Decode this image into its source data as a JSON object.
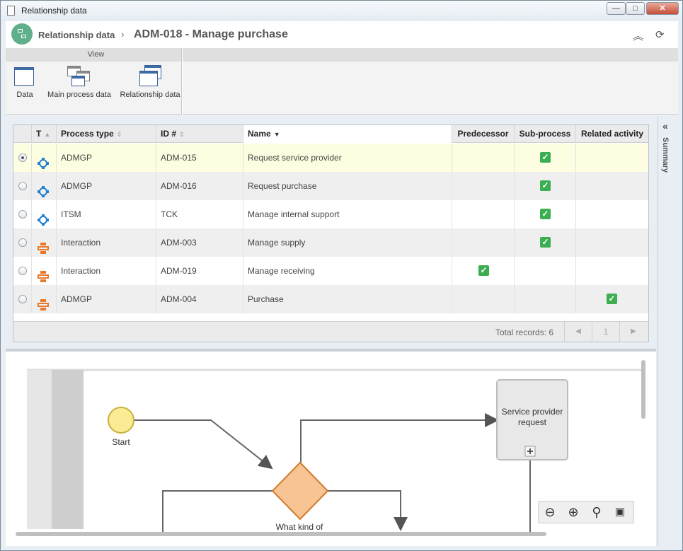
{
  "window": {
    "title": "Relationship data",
    "buttons": {
      "minimize": "—",
      "maximize": "□",
      "close": "✕"
    }
  },
  "header": {
    "breadcrumb_root": "Relationship data",
    "separator": "›",
    "title": "ADM-018 - Manage purchase"
  },
  "ribbon": {
    "group_label": "View",
    "buttons": [
      {
        "label": "Data",
        "icon": "data-grid-icon"
      },
      {
        "label": "Main process data",
        "icon": "main-process-data-icon"
      },
      {
        "label": "Relationship data",
        "icon": "relationship-data-icon"
      }
    ]
  },
  "grid": {
    "columns": {
      "type": "T",
      "process_type": "Process type",
      "id": "ID #",
      "name": "Name",
      "predecessor": "Predecessor",
      "subprocess": "Sub-process",
      "related_activity": "Related activity"
    },
    "rows": [
      {
        "process_type": "ADMGP",
        "id": "ADM-015",
        "name": "Request service provider",
        "icon": "process-icon-blue",
        "predecessor": false,
        "subprocess": true,
        "related_activity": false,
        "selected": true
      },
      {
        "process_type": "ADMGP",
        "id": "ADM-016",
        "name": "Request purchase",
        "icon": "process-icon-blue",
        "predecessor": false,
        "subprocess": true,
        "related_activity": false,
        "selected": false
      },
      {
        "process_type": "ITSM",
        "id": "TCK",
        "name": "Manage internal support",
        "icon": "process-icon-blue",
        "predecessor": false,
        "subprocess": true,
        "related_activity": false,
        "selected": false
      },
      {
        "process_type": "Interaction",
        "id": "ADM-003",
        "name": "Manage supply",
        "icon": "interaction-icon-orange",
        "predecessor": false,
        "subprocess": true,
        "related_activity": false,
        "selected": false
      },
      {
        "process_type": "Interaction",
        "id": "ADM-019",
        "name": "Manage receiving",
        "icon": "interaction-icon-orange",
        "predecessor": true,
        "subprocess": false,
        "related_activity": false,
        "selected": false
      },
      {
        "process_type": "ADMGP",
        "id": "ADM-004",
        "name": "Purchase",
        "icon": "interaction-icon-orange",
        "predecessor": false,
        "subprocess": false,
        "related_activity": true,
        "selected": false
      }
    ],
    "footer": {
      "total_label": "Total records: 6",
      "prev": "◀",
      "page": "1",
      "next": "▶"
    }
  },
  "sidebar": {
    "label": "Summary",
    "collapse_icon": "«"
  },
  "diagram": {
    "start_label": "Start",
    "task_label": "Service provider request",
    "gateway_label": "What kind of",
    "zoom_tools": [
      "zoom-out-icon",
      "zoom-in-icon",
      "zoom-fit-icon",
      "export-icon"
    ]
  },
  "colors": {
    "selected_row": "#fdfde1",
    "check_green": "#3cae52",
    "gateway_fill": "#f8c493",
    "start_fill": "#fbeb95",
    "logo": "#5fb08a"
  }
}
